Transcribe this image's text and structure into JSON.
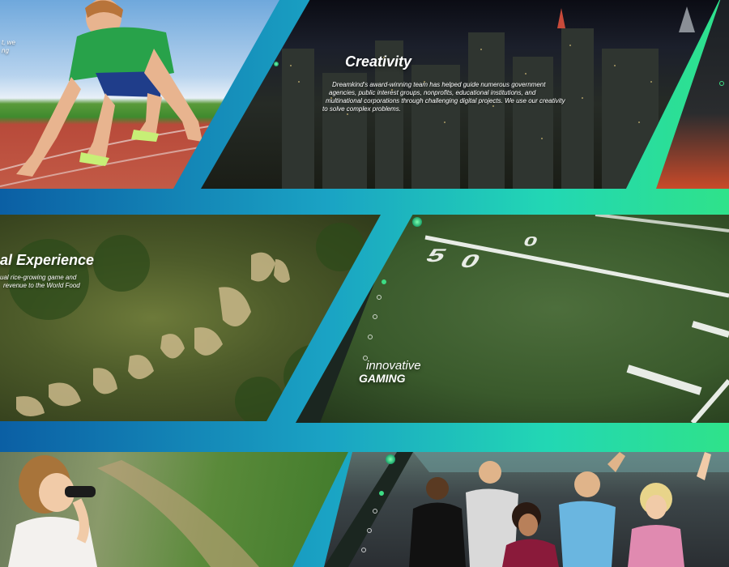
{
  "panels": {
    "runner": {
      "text_fragments": [
        "t, we",
        "ng"
      ]
    },
    "creativity": {
      "title": "Creativity",
      "lines": [
        "Dreamkind's award-winning team has helped guide numerous government",
        "agencies, public interest groups, nonprofits, educational institutions, and",
        "multinational corporations through challenging digital projects. We use our creativity",
        "to solve complex problems."
      ]
    },
    "experience": {
      "title": "al Experience",
      "lines": [
        "ual rice-growing game and",
        "revenue to the World Food"
      ]
    },
    "football": {
      "title_line1": "innovative",
      "title_line2": "GAMING",
      "field_number_left": "5",
      "field_number_right": "0",
      "field_number_left_b": "0"
    },
    "kids": {},
    "group": {}
  },
  "colors": {
    "band_start": "#0b5fa4",
    "band_end": "#2fe28a",
    "accent_dot": "#3ddc84"
  }
}
